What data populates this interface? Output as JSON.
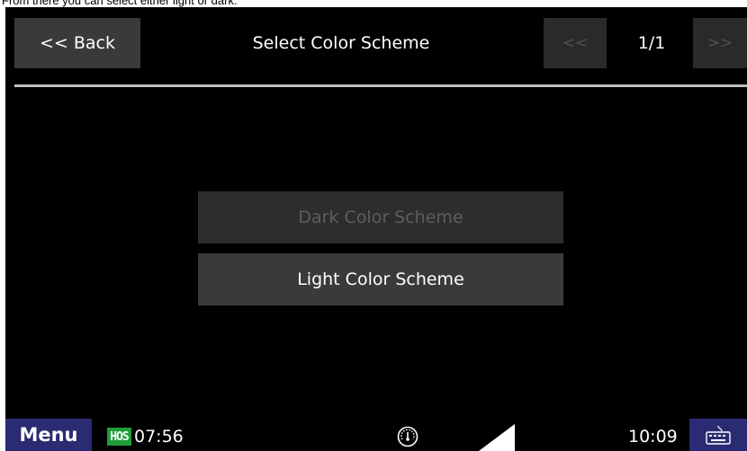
{
  "caption": "From there you can select either light or dark.",
  "header": {
    "back_label": "<< Back",
    "title": "Select Color Scheme",
    "prev_label": "<<",
    "page_indicator": "1/1",
    "next_label": ">>"
  },
  "options": [
    {
      "label": "Dark Color Scheme",
      "state": "disabled"
    },
    {
      "label": "Light Color Scheme",
      "state": "enabled"
    }
  ],
  "statusbar": {
    "menu_label": "Menu",
    "hos_badge": "HOS",
    "hos_time": "07:56",
    "clock": "10:09",
    "icons": [
      "speedometer-icon",
      "signal-strength-icon",
      "keyboard-icon"
    ]
  },
  "colors": {
    "background": "#000000",
    "button": "#3a3a3a",
    "menu_accent": "#2b2b73",
    "hos_green": "#1f9e3a",
    "disabled_text": "#5e5e5e"
  }
}
